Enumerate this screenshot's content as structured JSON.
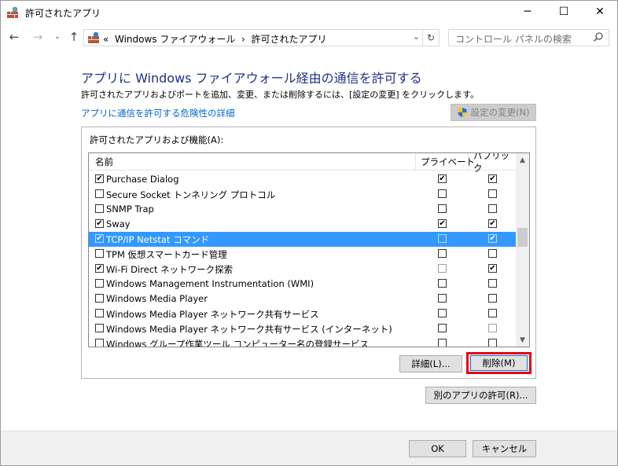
{
  "window": {
    "title": "許可されたアプリ",
    "minimize_glyph": "─",
    "maximize_glyph": "☐",
    "close_glyph": "✕"
  },
  "address_bar": {
    "path_prefix": "«",
    "crumbs": [
      "Windows ファイアウォール",
      "許可されたアプリ"
    ],
    "crumb_separator": "›",
    "search_placeholder": "コントロール パネルの検索"
  },
  "content": {
    "heading": "アプリに Windows ファイアウォール経由の通信を許可する",
    "description": "許可されたアプリおよびポートを追加、変更、または削除するには、[設定の変更] をクリックします。",
    "risk_link": "アプリに通信を許可する危険性の詳細",
    "change_settings_button": "設定の変更(N)"
  },
  "apps_list": {
    "group_label": "許可されたアプリおよび機能(A):",
    "columns": {
      "name": "名前",
      "private": "プライベート",
      "public": "パブリック"
    },
    "rows": [
      {
        "name": "Purchase Dialog",
        "enabled": true,
        "private": true,
        "public": true,
        "selected": false
      },
      {
        "name": "Secure Socket トンネリング プロトコル",
        "enabled": false,
        "private": false,
        "public": false,
        "selected": false
      },
      {
        "name": "SNMP Trap",
        "enabled": false,
        "private": false,
        "public": false,
        "selected": false
      },
      {
        "name": "Sway",
        "enabled": true,
        "private": true,
        "public": true,
        "selected": false
      },
      {
        "name": "TCP/IP Netstat コマンド",
        "enabled": true,
        "private": false,
        "public": true,
        "selected": true
      },
      {
        "name": "TPM 仮想スマートカード管理",
        "enabled": false,
        "private": false,
        "public": false,
        "selected": false
      },
      {
        "name": "Wi-Fi Direct ネットワーク探索",
        "enabled": true,
        "private": false,
        "public": true,
        "selected": false
      },
      {
        "name": "Windows Management Instrumentation (WMI)",
        "enabled": false,
        "private": false,
        "public": false,
        "selected": false
      },
      {
        "name": "Windows Media Player",
        "enabled": false,
        "private": false,
        "public": false,
        "selected": false
      },
      {
        "name": "Windows Media Player ネットワーク共有サービス",
        "enabled": false,
        "private": false,
        "public": false,
        "selected": false
      },
      {
        "name": "Windows Media Player ネットワーク共有サービス (インターネット)",
        "enabled": false,
        "private": false,
        "public": false,
        "selected": false
      },
      {
        "name": "Windows グループ作業ツール コンピューター名の登録サービス",
        "enabled": false,
        "private": false,
        "public": false,
        "selected": false
      }
    ],
    "details_button": "詳細(L)...",
    "remove_button": "削除(M)"
  },
  "allow_other_button": "別のアプリの許可(R)...",
  "footer": {
    "ok_button": "OK",
    "cancel_button": "キャンセル"
  },
  "colors": {
    "heading": "#1e3287",
    "link": "#0066cc",
    "selection": "#3399ff",
    "highlight_box": "#e8000b"
  }
}
